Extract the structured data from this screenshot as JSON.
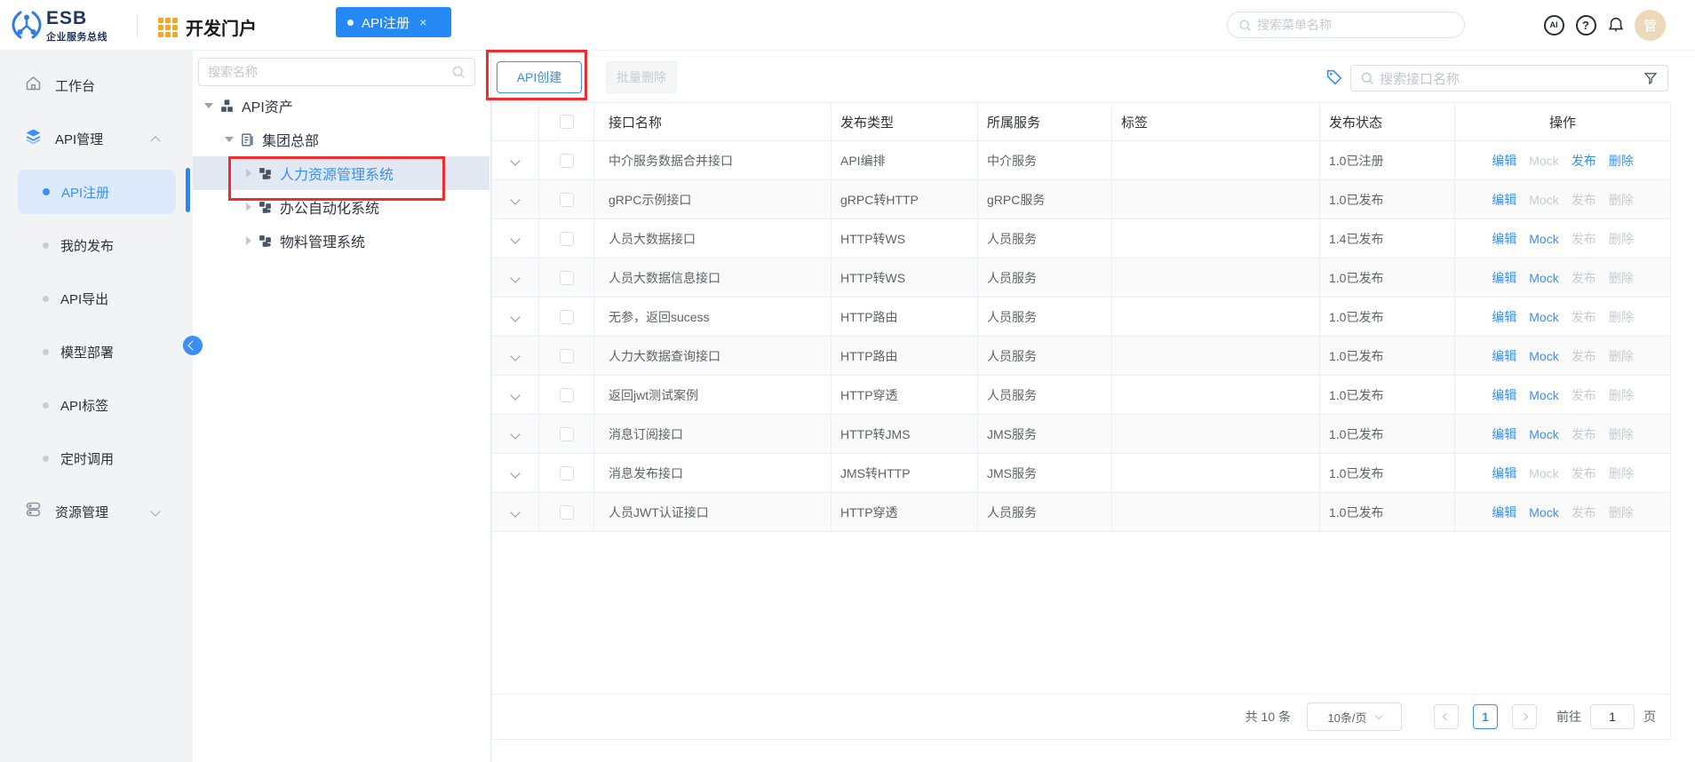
{
  "header": {
    "brand": "ESB",
    "brand_subtitle": "企业服务总线",
    "portal_label": "开发门户",
    "tab": {
      "label": "API注册",
      "close": "×"
    },
    "search_placeholder": "搜索菜单名称",
    "ai_label": "AI",
    "help_label": "?",
    "avatar_text": "管"
  },
  "sidebar": {
    "items": [
      {
        "label": "工作台",
        "icon": "home-icon",
        "type": "item"
      },
      {
        "label": "API管理",
        "icon": "layers-icon",
        "type": "group",
        "expanded": true,
        "children": [
          {
            "label": "API注册",
            "active": true
          },
          {
            "label": "我的发布",
            "active": false
          },
          {
            "label": "API导出",
            "active": false
          },
          {
            "label": "模型部署",
            "active": false
          },
          {
            "label": "API标签",
            "active": false
          },
          {
            "label": "定时调用",
            "active": false
          }
        ]
      },
      {
        "label": "资源管理",
        "icon": "database-icon",
        "type": "group",
        "expanded": false,
        "children": []
      }
    ]
  },
  "tree": {
    "search_placeholder": "搜索名称",
    "nodes": [
      {
        "label": "API资产",
        "level": 1,
        "state": "expanded",
        "icon": "asset-cubes-icon",
        "selected": false
      },
      {
        "label": "集团总部",
        "level": 2,
        "state": "expanded",
        "icon": "org-doc-icon",
        "selected": false
      },
      {
        "label": "人力资源管理系统",
        "level": 3,
        "state": "collapsed",
        "icon": "system-cubes-icon",
        "selected": true
      },
      {
        "label": "办公自动化系统",
        "level": 3,
        "state": "collapsed",
        "icon": "system-cubes-icon",
        "selected": false
      },
      {
        "label": "物料管理系统",
        "level": 3,
        "state": "collapsed",
        "icon": "system-cubes-icon",
        "selected": false
      }
    ]
  },
  "toolbar": {
    "create_label": "API创建",
    "batch_delete_label": "批量删除",
    "search_placeholder": "搜索接口名称"
  },
  "table": {
    "columns": [
      "接口名称",
      "发布类型",
      "所属服务",
      "标签",
      "发布状态",
      "操作"
    ],
    "action_labels": [
      "编辑",
      "Mock",
      "发布",
      "删除"
    ],
    "rows": [
      {
        "name": "中介服务数据合并接口",
        "type": "API编排",
        "service": "中介服务",
        "tag": "",
        "status": "1.0已注册",
        "actions": [
          true,
          false,
          true,
          true
        ]
      },
      {
        "name": "gRPC示例接口",
        "type": "gRPC转HTTP",
        "service": "gRPC服务",
        "tag": "",
        "status": "1.0已发布",
        "actions": [
          true,
          false,
          false,
          false
        ]
      },
      {
        "name": "人员大数据接口",
        "type": "HTTP转WS",
        "service": "人员服务",
        "tag": "",
        "status": "1.4已发布",
        "actions": [
          true,
          true,
          false,
          false
        ]
      },
      {
        "name": "人员大数据信息接口",
        "type": "HTTP转WS",
        "service": "人员服务",
        "tag": "",
        "status": "1.0已发布",
        "actions": [
          true,
          true,
          false,
          false
        ]
      },
      {
        "name": "无参，返回sucess",
        "type": "HTTP路由",
        "service": "人员服务",
        "tag": "",
        "status": "1.0已发布",
        "actions": [
          true,
          true,
          false,
          false
        ]
      },
      {
        "name": "人力大数据查询接口",
        "type": "HTTP路由",
        "service": "人员服务",
        "tag": "",
        "status": "1.0已发布",
        "actions": [
          true,
          true,
          false,
          false
        ]
      },
      {
        "name": "返回jwt测试案例",
        "type": "HTTP穿透",
        "service": "人员服务",
        "tag": "",
        "status": "1.0已发布",
        "actions": [
          true,
          true,
          false,
          false
        ]
      },
      {
        "name": "消息订阅接口",
        "type": "HTTP转JMS",
        "service": "JMS服务",
        "tag": "",
        "status": "1.0已发布",
        "actions": [
          true,
          true,
          false,
          false
        ]
      },
      {
        "name": "消息发布接口",
        "type": "JMS转HTTP",
        "service": "JMS服务",
        "tag": "",
        "status": "1.0已发布",
        "actions": [
          true,
          false,
          false,
          false
        ]
      },
      {
        "name": "人员JWT认证接口",
        "type": "HTTP穿透",
        "service": "人员服务",
        "tag": "",
        "status": "1.0已发布",
        "actions": [
          true,
          true,
          false,
          false
        ]
      }
    ]
  },
  "pagination": {
    "total": "共 10 条",
    "page_size": "10条/页",
    "current_page": "1",
    "goto_label": "前往",
    "goto_value": "1",
    "page_unit": "页"
  },
  "colors": {
    "primary": "#3a8ef6",
    "tab_bg": "#2589f5",
    "annotation_red": "#f22c2c",
    "sidebar_bg": "#f2f3f5",
    "sidebar_active_bg": "#dceafb",
    "tree_selected_bg": "#e2e9f3",
    "row_stripe": "#fafafa",
    "disabled_text": "#c8cbd1",
    "portal_icon_orange": "#f6a623",
    "brand_navy": "#22355c",
    "avatar_bg": "#ecd9ba"
  }
}
